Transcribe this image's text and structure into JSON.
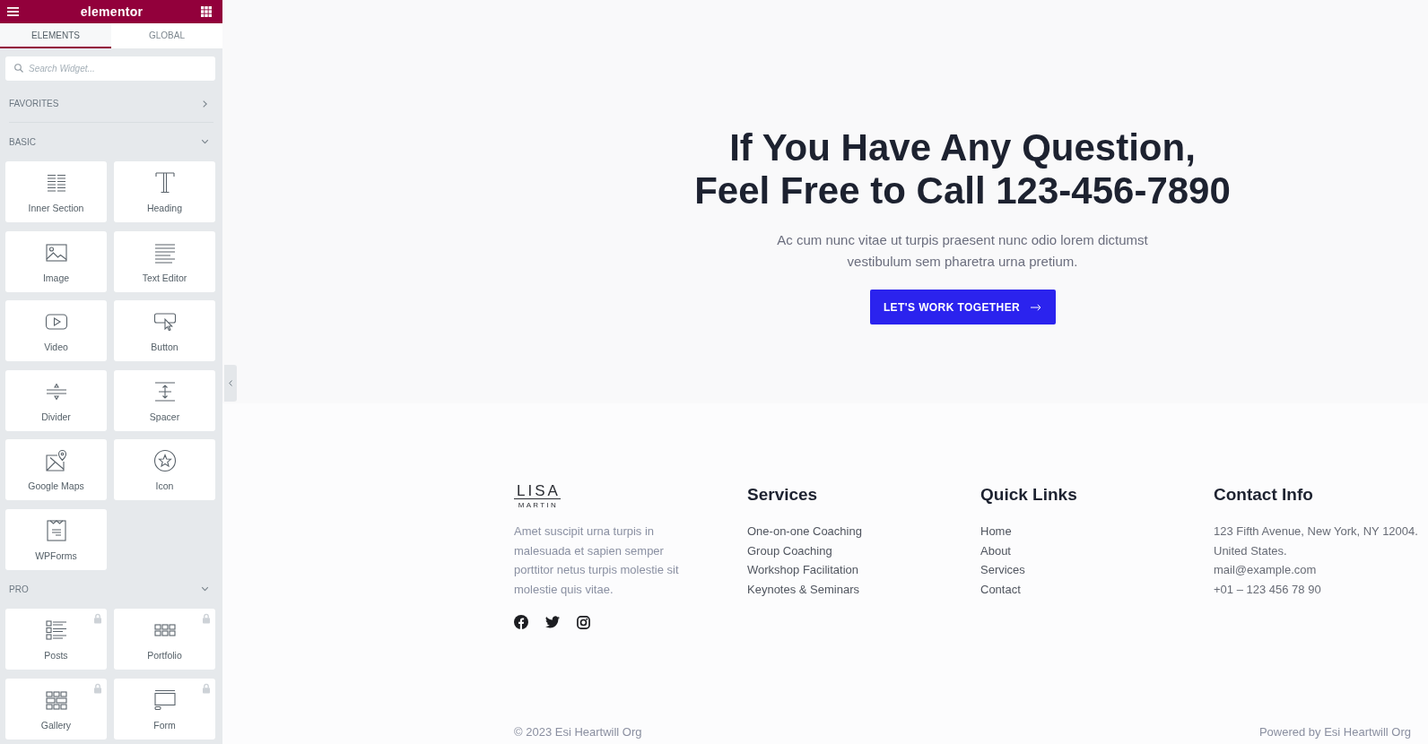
{
  "editor_panel": {
    "header": {
      "title": "elementor"
    },
    "tabs": [
      {
        "label": "ELEMENTS",
        "selected": true
      },
      {
        "label": "GLOBAL",
        "selected": false
      }
    ],
    "search": {
      "placeholder": "Search Widget..."
    },
    "categories": [
      {
        "title": "FAVORITES",
        "expanded": false
      },
      {
        "title": "BASIC",
        "expanded": true,
        "widgets": [
          {
            "label": "Inner Section",
            "locked": false
          },
          {
            "label": "Heading",
            "locked": false
          },
          {
            "label": "Image",
            "locked": false
          },
          {
            "label": "Text Editor",
            "locked": false
          },
          {
            "label": "Video",
            "locked": false
          },
          {
            "label": "Button",
            "locked": false
          },
          {
            "label": "Divider",
            "locked": false
          },
          {
            "label": "Spacer",
            "locked": false
          },
          {
            "label": "Google Maps",
            "locked": false
          },
          {
            "label": "Icon",
            "locked": false
          },
          {
            "label": "WPForms",
            "locked": false
          }
        ]
      },
      {
        "title": "PRO",
        "expanded": true,
        "widgets": [
          {
            "label": "Posts",
            "locked": true
          },
          {
            "label": "Portfolio",
            "locked": true
          },
          {
            "label": "Gallery",
            "locked": true
          },
          {
            "label": "Form",
            "locked": true
          }
        ]
      }
    ]
  },
  "hero": {
    "heading": "If You Have Any Question,\nFeel Free to Call 123-456-7890",
    "text": "Ac cum nunc vitae ut turpis praesent nunc odio lorem dictumst vestibulum sem pharetra urna pretium.",
    "button": {
      "label": "LET'S WORK TOGETHER"
    }
  },
  "footer": {
    "brand": {
      "logo_top": "LISA",
      "logo_bottom": "MARTIN",
      "description": "Amet suscipit urna turpis in malesuada et sapien semper porttitor netus turpis molestie sit molestie quis vitae."
    },
    "columns": [
      {
        "title": "Services",
        "kind": "links",
        "items": [
          "One-on-one Coaching",
          "Group Coaching",
          "Workshop Facilitation",
          "Keynotes & Seminars"
        ]
      },
      {
        "title": "Quick Links",
        "kind": "links",
        "items": [
          "Home",
          "About",
          "Services",
          "Contact"
        ]
      },
      {
        "title": "Contact Info",
        "kind": "info",
        "items": [
          "123 Fifth Avenue, New York, NY 12004.",
          "United States.",
          "mail@example.com",
          "+01 – 123 456 78 90"
        ]
      }
    ],
    "copyright": "© 2023 Esi Heartwill Org",
    "credit": "Powered by Esi Heartwill Org"
  }
}
